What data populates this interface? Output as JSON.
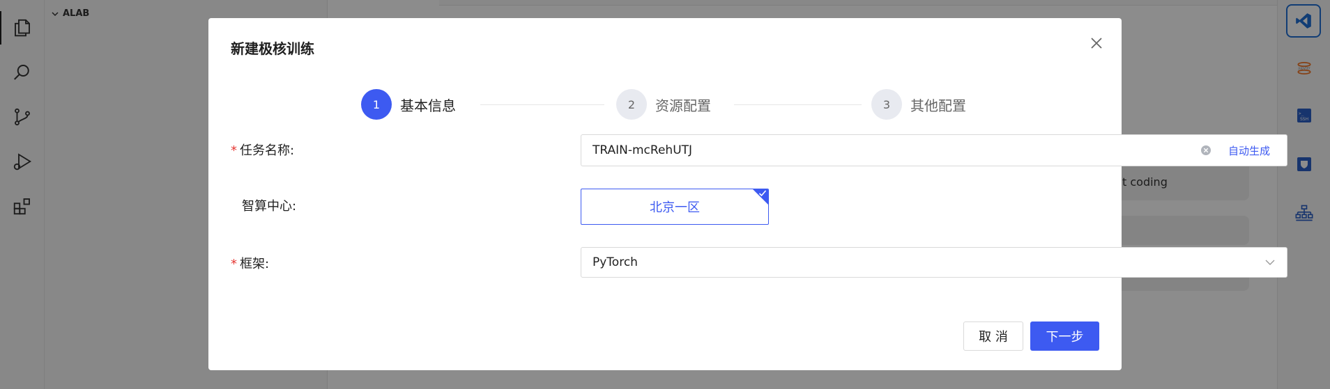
{
  "ide": {
    "explorer_section": "ALAB",
    "editor_card_text": "t coding",
    "activity_icons": [
      "files-icon",
      "search-icon",
      "source-control-icon",
      "run-debug-icon",
      "extensions-icon"
    ],
    "right_icons": [
      "vscode-icon",
      "jupyter-icon",
      "ssh-icon",
      "shield-icon",
      "network-icon"
    ]
  },
  "modal": {
    "title": "新建极核训练",
    "steps": [
      {
        "number": "1",
        "label": "基本信息",
        "state": "active"
      },
      {
        "number": "2",
        "label": "资源配置",
        "state": "inactive"
      },
      {
        "number": "3",
        "label": "其他配置",
        "state": "inactive"
      }
    ],
    "form": {
      "task_name": {
        "label": "任务名称:",
        "required": true,
        "value": "TRAIN-mcRehUTJ",
        "action": "自动生成"
      },
      "compute_center": {
        "label": "智算中心:",
        "required": false,
        "selected": "北京一区"
      },
      "framework": {
        "label": "框架:",
        "required": true,
        "value": "PyTorch"
      }
    },
    "buttons": {
      "cancel": "取 消",
      "next": "下一步"
    }
  },
  "colors": {
    "primary": "#3d5af1",
    "required_mark": "#e53935",
    "overlay": "rgba(0,0,0,0.45)"
  }
}
